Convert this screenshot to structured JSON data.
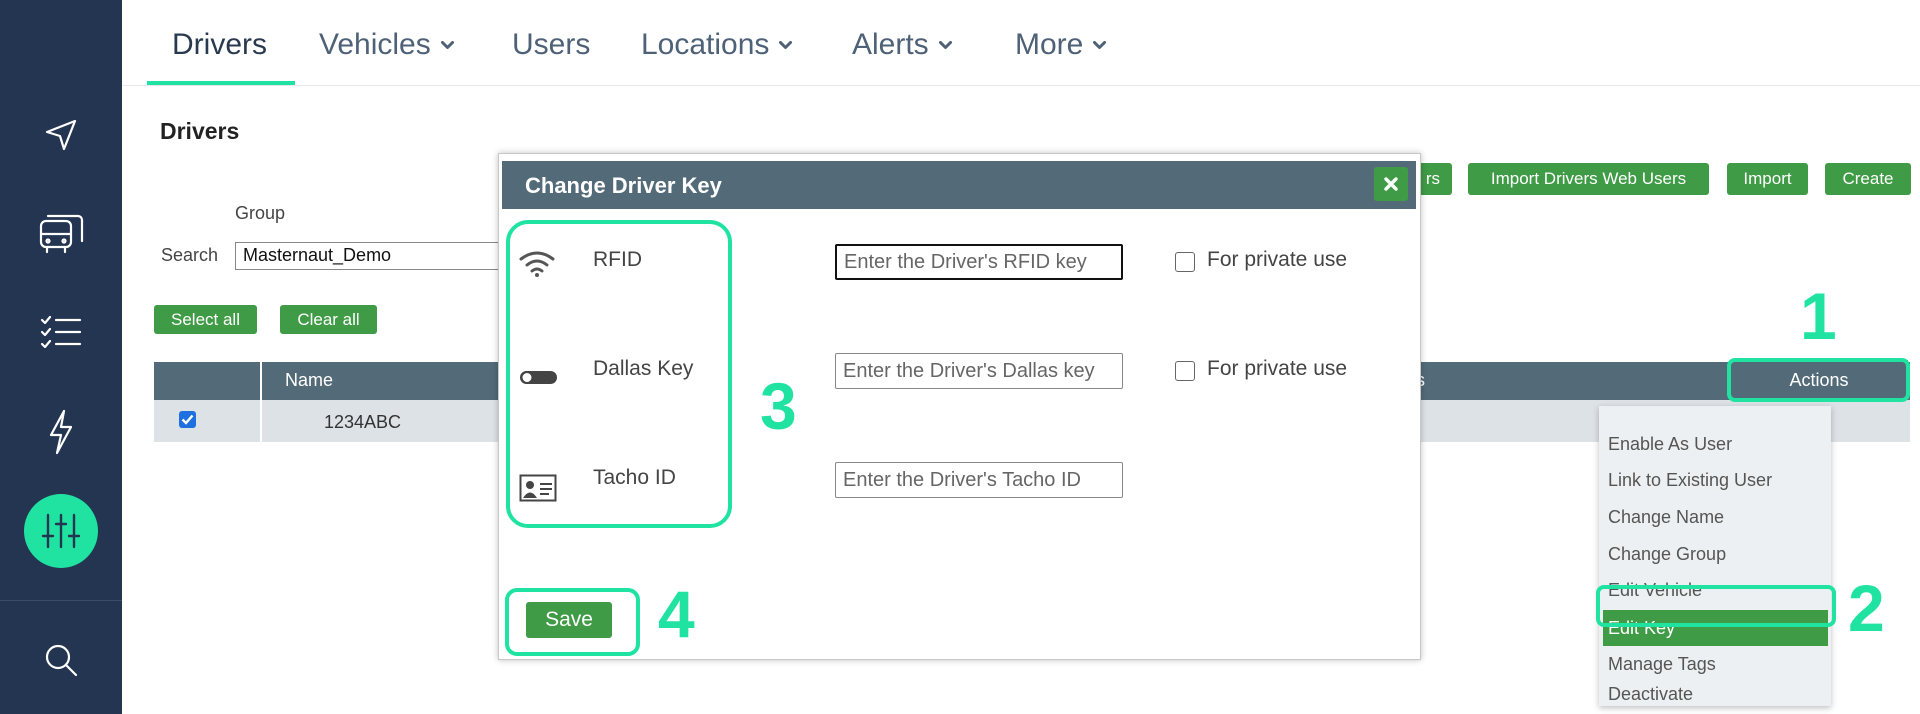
{
  "nav": {
    "tabs": [
      {
        "label": "Drivers",
        "active": true
      },
      {
        "label": "Vehicles"
      },
      {
        "label": "Users"
      },
      {
        "label": "Locations"
      },
      {
        "label": "Alerts"
      },
      {
        "label": "More"
      }
    ]
  },
  "sidebar": {
    "icons": [
      "navigation-arrow-icon",
      "bus-icon",
      "checklist-icon",
      "lightning-icon",
      "sliders-icon",
      "search-icon"
    ],
    "active_color": "#20e3a2"
  },
  "page": {
    "title": "Drivers",
    "group_label": "Group",
    "search_label": "Search",
    "search_value": "Masternaut_Demo"
  },
  "toolbar": {
    "partial_button": "rs",
    "import_web_users": "Import Drivers Web Users",
    "import": "Import",
    "create": "Create",
    "select_all": "Select all",
    "clear_all": "Clear all"
  },
  "table": {
    "col_name": "Name",
    "col_partial": "s",
    "col_actions": "Actions",
    "rows": [
      {
        "checked": true,
        "name": "1234ABC"
      }
    ]
  },
  "actions_menu": {
    "items": [
      "Enable As User",
      "Link to Existing User",
      "Change Name",
      "Change Group",
      "Edit Vehicle",
      "Edit Key",
      "Manage Tags",
      "Deactivate"
    ],
    "highlighted": "Edit Key"
  },
  "modal": {
    "title": "Change Driver Key",
    "rows": [
      {
        "icon": "wifi-icon",
        "label": "RFID",
        "placeholder": "Enter the Driver's RFID key",
        "private_label": "For private use"
      },
      {
        "icon": "toggle-icon",
        "label": "Dallas Key",
        "placeholder": "Enter the Driver's Dallas key",
        "private_label": "For private use"
      },
      {
        "icon": "id-card-icon",
        "label": "Tacho ID",
        "placeholder": "Enter the Driver's Tacho ID"
      }
    ],
    "save_label": "Save"
  },
  "annotations": {
    "color": "#20e3a2",
    "steps": [
      "1",
      "2",
      "3",
      "4"
    ]
  },
  "colors": {
    "sidebar": "#233550",
    "green_button": "#3f9b45",
    "table_header": "#536b78",
    "accent": "#20e3a2"
  }
}
